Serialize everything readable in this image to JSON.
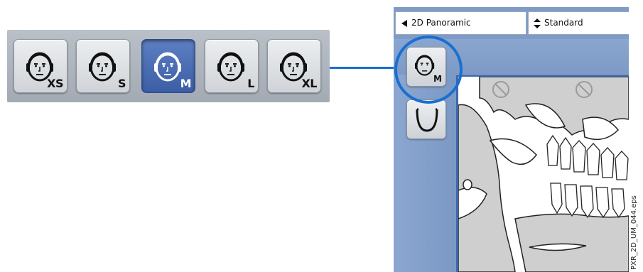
{
  "size_selector": {
    "buttons": [
      {
        "label": "XS",
        "active": false
      },
      {
        "label": "S",
        "active": false
      },
      {
        "label": "M",
        "active": true
      },
      {
        "label": "L",
        "active": false
      },
      {
        "label": "XL",
        "active": false
      }
    ]
  },
  "screen": {
    "program_dropdown": {
      "value": "2D Panoramic"
    },
    "mode_dropdown": {
      "value": "Standard"
    },
    "patient_size_button": {
      "label": "M"
    }
  },
  "file_reference": "PXR_2D_UM_044.eps",
  "colors": {
    "accent": "#1a6fd0",
    "active_button": "#4a6db3",
    "screen_background": "#7f9bc7"
  }
}
